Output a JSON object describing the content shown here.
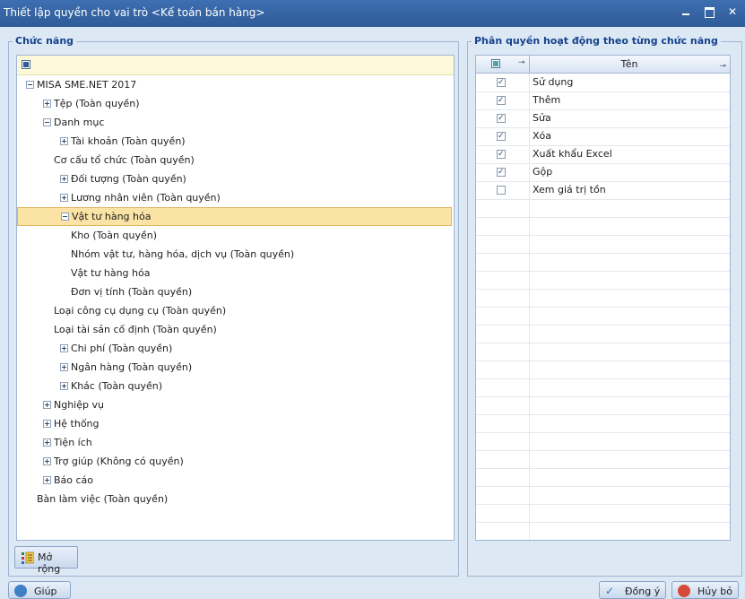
{
  "window": {
    "title": "Thiết lập quyền cho vai trò <Kế toán bán hàng>"
  },
  "left_panel": {
    "title": "Chức năng",
    "expand_button": "Mở rộng",
    "tree": [
      {
        "label": "MISA SME.NET 2017",
        "level": 0,
        "toggle": "minus"
      },
      {
        "label": "Tệp (Toàn quyền)",
        "level": 1,
        "toggle": "plus"
      },
      {
        "label": "Danh mục",
        "level": 1,
        "toggle": "minus"
      },
      {
        "label": "Tài khoản (Toàn quyền)",
        "level": 2,
        "toggle": "plus"
      },
      {
        "label": "Cơ cấu tổ chức (Toàn quyền)",
        "level": 2,
        "toggle": "none"
      },
      {
        "label": "Đối tượng (Toàn quyền)",
        "level": 2,
        "toggle": "plus"
      },
      {
        "label": "Lương nhân viên (Toàn quyền)",
        "level": 2,
        "toggle": "plus"
      },
      {
        "label": "Vật tư hàng hóa",
        "level": 2,
        "toggle": "minus",
        "selected": true
      },
      {
        "label": "Kho (Toàn quyền)",
        "level": 3,
        "toggle": "none"
      },
      {
        "label": "Nhóm vật tư, hàng hóa, dịch vụ (Toàn quyền)",
        "level": 3,
        "toggle": "none"
      },
      {
        "label": "Vật tư hàng hóa",
        "level": 3,
        "toggle": "none"
      },
      {
        "label": "Đơn vị tính (Toàn quyền)",
        "level": 3,
        "toggle": "none"
      },
      {
        "label": "Loại công cụ dụng cụ (Toàn quyền)",
        "level": 2,
        "toggle": "none"
      },
      {
        "label": "Loại tài sản cố định (Toàn quyền)",
        "level": 2,
        "toggle": "none"
      },
      {
        "label": "Chi phí (Toàn quyền)",
        "level": 2,
        "toggle": "plus"
      },
      {
        "label": "Ngân hàng (Toàn quyền)",
        "level": 2,
        "toggle": "plus"
      },
      {
        "label": "Khác (Toàn quyền)",
        "level": 2,
        "toggle": "plus"
      },
      {
        "label": "Nghiệp vụ",
        "level": 1,
        "toggle": "plus"
      },
      {
        "label": "Hệ thống",
        "level": 1,
        "toggle": "plus"
      },
      {
        "label": "Tiện ích",
        "level": 1,
        "toggle": "plus"
      },
      {
        "label": "Trợ giúp (Không có quyền)",
        "level": 1,
        "toggle": "plus"
      },
      {
        "label": "Báo cáo",
        "level": 1,
        "toggle": "plus"
      },
      {
        "label": "Bàn làm việc (Toàn quyền)",
        "level": 1,
        "toggle": "none"
      }
    ]
  },
  "right_panel": {
    "title": "Phân quyền hoạt động theo từng chức năng",
    "column_name": "Tên",
    "rows": [
      {
        "name": "Sử dụng",
        "checked": true
      },
      {
        "name": "Thêm",
        "checked": true
      },
      {
        "name": "Sửa",
        "checked": true
      },
      {
        "name": "Xóa",
        "checked": true
      },
      {
        "name": "Xuất khẩu Excel",
        "checked": true
      },
      {
        "name": "Gộp",
        "checked": true
      },
      {
        "name": "Xem giá trị tồn",
        "checked": false
      }
    ]
  },
  "footer": {
    "help": "Giúp",
    "ok": "Đồng ý",
    "cancel": "Hủy bỏ"
  }
}
